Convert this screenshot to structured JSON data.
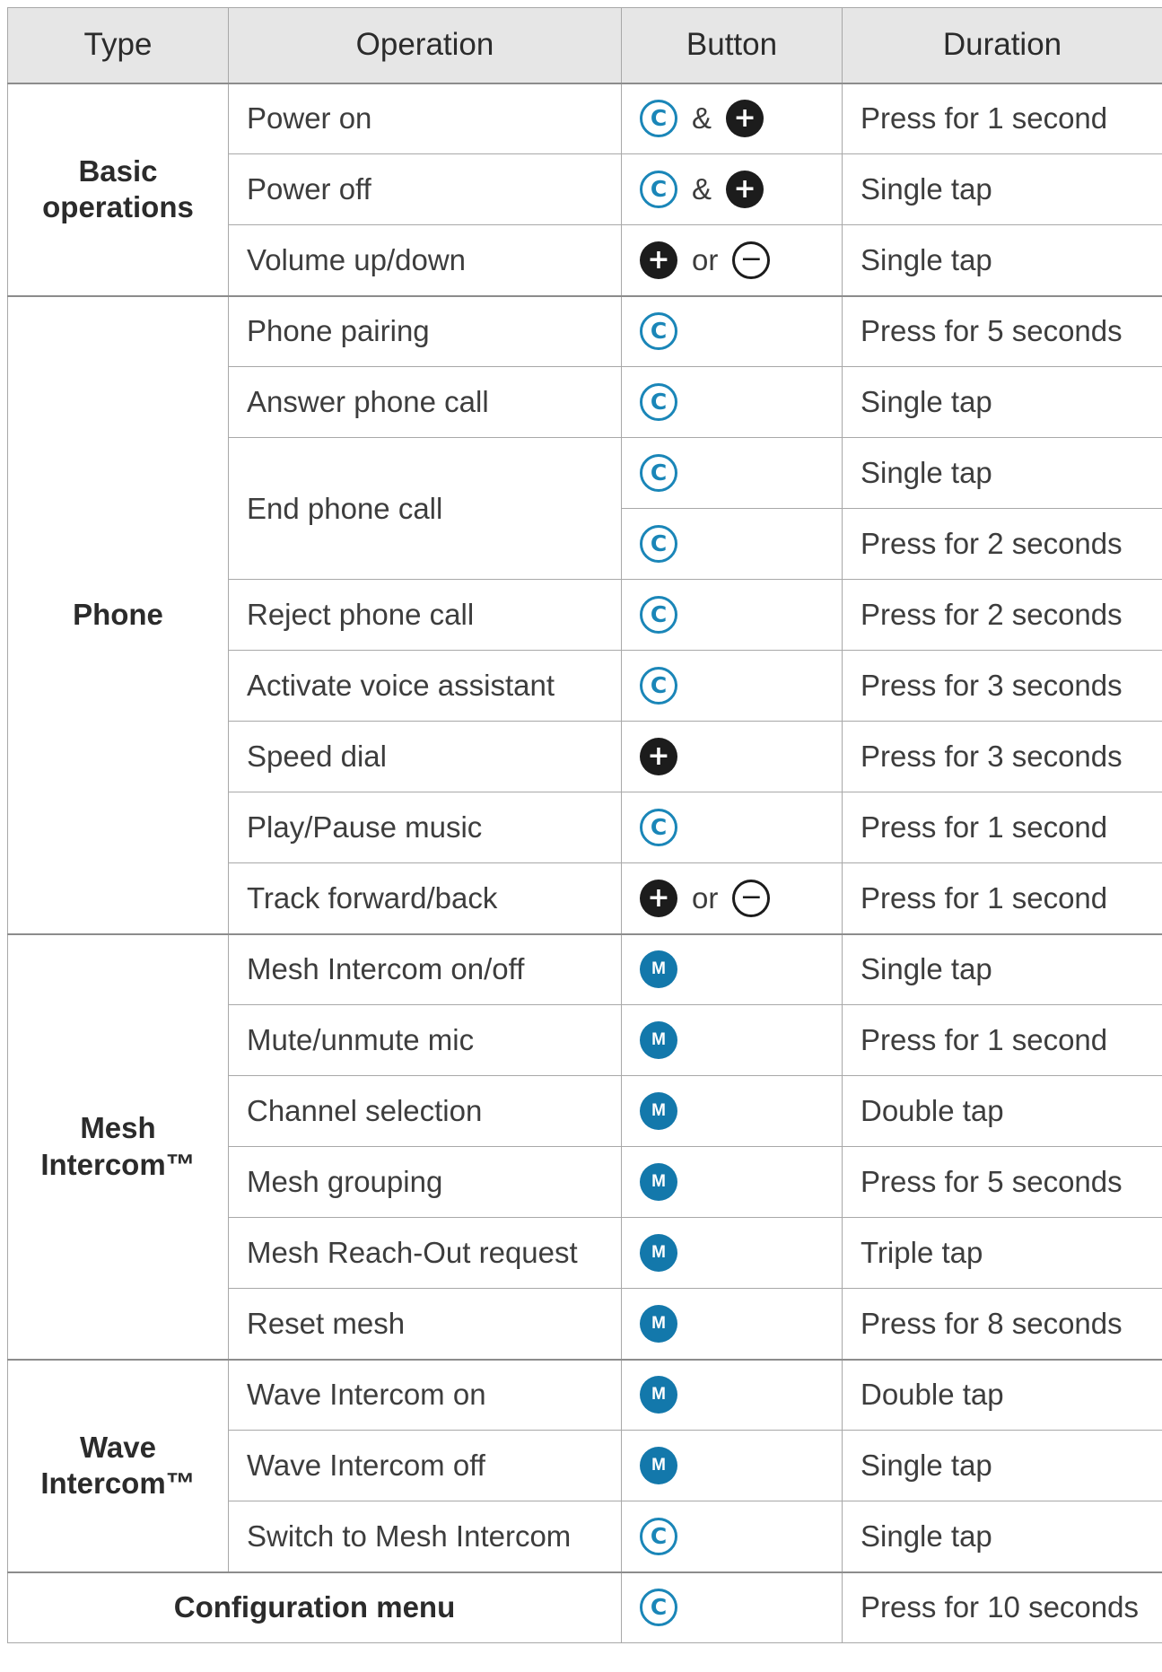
{
  "headers": {
    "type": "Type",
    "operation": "Operation",
    "button": "Button",
    "duration": "Duration"
  },
  "icons": {
    "c": {
      "name": "phone-button-icon",
      "glyph": "C",
      "color": "#1a86b8"
    },
    "plus": {
      "name": "plus-button-icon",
      "glyph": "+",
      "color": "#1c1c1c"
    },
    "minus": {
      "name": "minus-button-icon",
      "glyph": "−",
      "color": "#1c1c1c"
    },
    "m": {
      "name": "mesh-button-icon",
      "glyph": "M",
      "color": "#1378ab"
    }
  },
  "groups": [
    {
      "type": "Basic\noperations",
      "rows": [
        {
          "op": "Power on",
          "btn": [
            "c",
            "&",
            "plus"
          ],
          "dur": "Press for 1 second"
        },
        {
          "op": "Power off",
          "btn": [
            "c",
            "&",
            "plus"
          ],
          "dur": "Single tap"
        },
        {
          "op": "Volume up/down",
          "btn": [
            "plus",
            "or",
            "minus"
          ],
          "dur": "Single tap"
        }
      ]
    },
    {
      "type": "Phone",
      "rows": [
        {
          "op": "Phone pairing",
          "btn": [
            "c"
          ],
          "dur": "Press for 5 seconds"
        },
        {
          "op": "Answer phone call",
          "btn": [
            "c"
          ],
          "dur": "Single tap"
        },
        {
          "op": "End phone call",
          "span": 2,
          "btn": [
            "c"
          ],
          "dur": "Single tap"
        },
        {
          "btn": [
            "c"
          ],
          "dur": "Press for 2 seconds"
        },
        {
          "op": "Reject phone call",
          "btn": [
            "c"
          ],
          "dur": "Press for 2 seconds"
        },
        {
          "op": "Activate voice assistant",
          "btn": [
            "c"
          ],
          "dur": "Press for 3 seconds"
        },
        {
          "op": "Speed dial",
          "btn": [
            "plus"
          ],
          "dur": "Press for 3 seconds"
        },
        {
          "op": "Play/Pause music",
          "btn": [
            "c"
          ],
          "dur": "Press for 1 second"
        },
        {
          "op": "Track forward/back",
          "btn": [
            "plus",
            "or",
            "minus"
          ],
          "dur": "Press for 1 second"
        }
      ]
    },
    {
      "type": "Mesh\nIntercom™",
      "rows": [
        {
          "op": "Mesh Intercom on/off",
          "btn": [
            "m"
          ],
          "dur": "Single tap"
        },
        {
          "op": "Mute/unmute mic",
          "btn": [
            "m"
          ],
          "dur": "Press for 1 second"
        },
        {
          "op": "Channel selection",
          "btn": [
            "m"
          ],
          "dur": "Double tap"
        },
        {
          "op": "Mesh grouping",
          "btn": [
            "m"
          ],
          "dur": "Press for 5 seconds"
        },
        {
          "op": "Mesh Reach-Out request",
          "btn": [
            "m"
          ],
          "dur": "Triple tap"
        },
        {
          "op": "Reset mesh",
          "btn": [
            "m"
          ],
          "dur": "Press for 8 seconds"
        }
      ]
    },
    {
      "type": "Wave\nIntercom™",
      "rows": [
        {
          "op": "Wave Intercom on",
          "btn": [
            "m"
          ],
          "dur": "Double tap"
        },
        {
          "op": "Wave Intercom off",
          "btn": [
            "m"
          ],
          "dur": "Single tap"
        },
        {
          "op": "Switch to Mesh Intercom",
          "btn": [
            "c"
          ],
          "dur": "Single tap"
        }
      ]
    }
  ],
  "config": {
    "label": "Configuration menu",
    "btn": [
      "c"
    ],
    "dur": "Press for 10 seconds"
  }
}
